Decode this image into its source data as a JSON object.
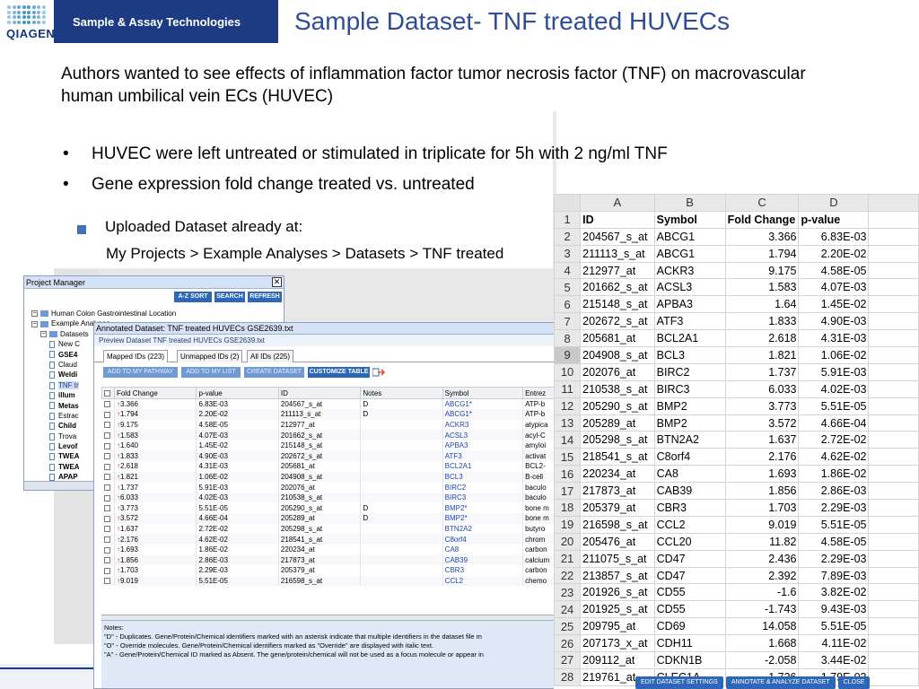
{
  "header": {
    "logo_text": "QIAGEN",
    "brand_label": "Sample & Assay Technologies",
    "title": "Sample Dataset- TNF treated HUVECs"
  },
  "intro": "Authors wanted to see effects of inflammation factor tumor necrosis factor (TNF) on macrovascular human umbilical vein ECs (HUVEC)",
  "bullets": [
    "HUVEC were left untreated or stimulated in triplicate for 5h with 2 ng/ml TNF",
    "Gene expression fold change treated vs. untreated"
  ],
  "sub_bullet": {
    "label": "Uploaded Dataset already at:",
    "path": "My Projects > Example Analyses > Datasets > TNF treated"
  },
  "project_manager": {
    "title": "Project Manager",
    "buttons": [
      "A-Z SORT",
      "SEARCH",
      "REFRESH"
    ],
    "tree": [
      {
        "label": "Human Colon Gastrointestinal Location",
        "level": 1,
        "kind": "folder"
      },
      {
        "label": "Example Analyses",
        "level": 1,
        "kind": "folder"
      },
      {
        "label": "Datasets",
        "level": 2,
        "kind": "folder"
      },
      {
        "label": "New C",
        "level": 3,
        "kind": "doc"
      },
      {
        "label": "GSE4",
        "level": 3,
        "kind": "doc",
        "bold": true
      },
      {
        "label": "Claud",
        "level": 3,
        "kind": "doc"
      },
      {
        "label": "Weldi",
        "level": 3,
        "kind": "doc",
        "bold": true
      },
      {
        "label": "TNF tr",
        "level": 3,
        "kind": "doc",
        "selected": true
      },
      {
        "label": "illum",
        "level": 3,
        "kind": "doc",
        "bold": true
      },
      {
        "label": "Metas",
        "level": 3,
        "kind": "doc",
        "bold": true
      },
      {
        "label": "Estrac",
        "level": 3,
        "kind": "doc"
      },
      {
        "label": "Child",
        "level": 3,
        "kind": "doc",
        "bold": true
      },
      {
        "label": "Trova",
        "level": 3,
        "kind": "doc"
      },
      {
        "label": "Levof",
        "level": 3,
        "kind": "doc",
        "bold": true
      },
      {
        "label": "TWEA",
        "level": 3,
        "kind": "doc",
        "bold": true
      },
      {
        "label": "TWEA",
        "level": 3,
        "kind": "doc",
        "bold": true
      },
      {
        "label": "APAP",
        "level": 3,
        "kind": "doc",
        "bold": true
      }
    ]
  },
  "annotated_dataset": {
    "title": "Annotated Dataset: TNF treated HUVECs GSE2639.txt",
    "subtitle": "Preview Dataset TNF treated HUVECs GSE2639.txt",
    "tabs": [
      "Mapped IDs (223)",
      "Unmapped IDs (2)",
      "All IDs (225)"
    ],
    "buttons": [
      "ADD TO MY PATHWAY",
      "ADD TO MY LIST",
      "CREATE DATASET",
      "CUSTOMIZE TABLE"
    ],
    "columns": [
      "Fold Change",
      "p-value",
      "ID",
      "Notes",
      "Symbol",
      "Entrez"
    ],
    "rows": [
      [
        "3.366",
        "6.83E-03",
        "204567_s_at",
        "D",
        "ABCG1*",
        "ATP-b"
      ],
      [
        "1.794",
        "2.20E-02",
        "211113_s_at",
        "D",
        "ABCG1*",
        "ATP-b"
      ],
      [
        "9.175",
        "4.58E-05",
        "212977_at",
        "",
        "ACKR3",
        "atypica"
      ],
      [
        "1.583",
        "4.07E-03",
        "201662_s_at",
        "",
        "ACSL3",
        "acyl-C"
      ],
      [
        "1.640",
        "1.45E-02",
        "215148_s_at",
        "",
        "APBA3",
        "amyloi"
      ],
      [
        "1.833",
        "4.90E-03",
        "202672_s_at",
        "",
        "ATF3",
        "activat"
      ],
      [
        "2.618",
        "4.31E-03",
        "205681_at",
        "",
        "BCL2A1",
        "BCL2-"
      ],
      [
        "1.821",
        "1.06E-02",
        "204908_s_at",
        "",
        "BCL3",
        "B-cell"
      ],
      [
        "1.737",
        "5.91E-03",
        "202076_at",
        "",
        "BIRC2",
        "baculo"
      ],
      [
        "6.033",
        "4.02E-03",
        "210538_s_at",
        "",
        "BIRC3",
        "baculo"
      ],
      [
        "3.773",
        "5.51E-05",
        "205290_s_at",
        "D",
        "BMP2*",
        "bone m"
      ],
      [
        "3.572",
        "4.66E-04",
        "205289_at",
        "D",
        "BMP2*",
        "bone m"
      ],
      [
        "1.637",
        "2.72E-02",
        "205298_s_at",
        "",
        "BTN2A2",
        "butyro"
      ],
      [
        "2.176",
        "4.62E-02",
        "218541_s_at",
        "",
        "C8orf4",
        "chrom"
      ],
      [
        "1.693",
        "1.86E-02",
        "220234_at",
        "",
        "CA8",
        "carbon"
      ],
      [
        "1.856",
        "2.86E-03",
        "217873_at",
        "",
        "CAB39",
        "calcium"
      ],
      [
        "1.703",
        "2.29E-03",
        "205379_at",
        "",
        "CBR3",
        "carbon"
      ],
      [
        "9.019",
        "5.51E-05",
        "216598_s_at",
        "",
        "CCL2",
        "chemo"
      ]
    ],
    "notes": [
      "Notes:",
      "\"D\" - Duplicates. Gene/Protein/Chemical identifiers marked with an asterisk indicate that multiple identifiers in the dataset file m",
      "\"O\" - Override molecules. Gene/Protein/Chemical identifiers marked as \"Override\" are displayed with italic text.",
      "\"A\" - Gene/Protein/Chemical ID marked as Absent. The gene/protein/chemical will not be used as a focus molecule or appear in"
    ]
  },
  "spreadsheet": {
    "col_letters": [
      "A",
      "B",
      "C",
      "D"
    ],
    "header": [
      "ID",
      "Symbol",
      "Fold Change",
      "p-value"
    ],
    "selected_row": 9,
    "rows": [
      [
        "204567_s_at",
        "ABCG1",
        "3.366",
        "6.83E-03"
      ],
      [
        "211113_s_at",
        "ABCG1",
        "1.794",
        "2.20E-02"
      ],
      [
        "212977_at",
        "ACKR3",
        "9.175",
        "4.58E-05"
      ],
      [
        "201662_s_at",
        "ACSL3",
        "1.583",
        "4.07E-03"
      ],
      [
        "215148_s_at",
        "APBA3",
        "1.64",
        "1.45E-02"
      ],
      [
        "202672_s_at",
        "ATF3",
        "1.833",
        "4.90E-03"
      ],
      [
        "205681_at",
        "BCL2A1",
        "2.618",
        "4.31E-03"
      ],
      [
        "204908_s_at",
        "BCL3",
        "1.821",
        "1.06E-02"
      ],
      [
        "202076_at",
        "BIRC2",
        "1.737",
        "5.91E-03"
      ],
      [
        "210538_s_at",
        "BIRC3",
        "6.033",
        "4.02E-03"
      ],
      [
        "205290_s_at",
        "BMP2",
        "3.773",
        "5.51E-05"
      ],
      [
        "205289_at",
        "BMP2",
        "3.572",
        "4.66E-04"
      ],
      [
        "205298_s_at",
        "BTN2A2",
        "1.637",
        "2.72E-02"
      ],
      [
        "218541_s_at",
        "C8orf4",
        "2.176",
        "4.62E-02"
      ],
      [
        "220234_at",
        "CA8",
        "1.693",
        "1.86E-02"
      ],
      [
        "217873_at",
        "CAB39",
        "1.856",
        "2.86E-03"
      ],
      [
        "205379_at",
        "CBR3",
        "1.703",
        "2.29E-03"
      ],
      [
        "216598_s_at",
        "CCL2",
        "9.019",
        "5.51E-05"
      ],
      [
        "205476_at",
        "CCL20",
        "11.82",
        "4.58E-05"
      ],
      [
        "211075_s_at",
        "CD47",
        "2.436",
        "2.29E-03"
      ],
      [
        "213857_s_at",
        "CD47",
        "2.392",
        "7.89E-03"
      ],
      [
        "201926_s_at",
        "CD55",
        "-1.6",
        "3.82E-02"
      ],
      [
        "201925_s_at",
        "CD55",
        "-1.743",
        "9.43E-03"
      ],
      [
        "209795_at",
        "CD69",
        "14.058",
        "5.51E-05"
      ],
      [
        "207173_x_at",
        "CDH11",
        "1.668",
        "4.11E-02"
      ],
      [
        "209112_at",
        "CDKN1B",
        "-2.058",
        "3.44E-02"
      ],
      [
        "219761_at",
        "CLEC1A",
        "1.736",
        "1.79E-03"
      ]
    ]
  },
  "bottom_buttons": [
    "EDIT DATASET SETTINGS",
    "ANNOTATE & ANALYZE DATASET",
    "CLOSE"
  ],
  "colors": {
    "brand_blue": "#1d3b82",
    "title_blue": "#2f4d96",
    "button_blue": "#2e66b8"
  }
}
